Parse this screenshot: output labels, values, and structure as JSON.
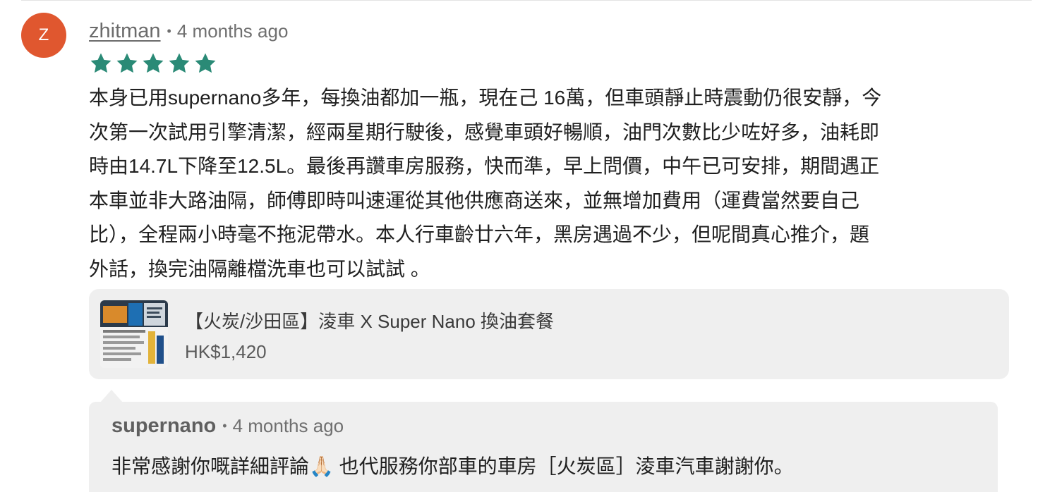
{
  "review": {
    "avatar_initial": "Z",
    "avatar_color": "#e0572f",
    "username": "zhitman",
    "separator": "•",
    "timestamp": "4 months ago",
    "rating": 5,
    "star_color": "#2a8a76",
    "body_lines": [
      "本身已用supernano多年，每換油都加一瓶，現在己 16萬，但車頭靜止時震動仍很安靜，今",
      "次第一次試用引擎清潔，經兩星期行駛後，感覺車頭好暢順，油門次數比少咗好多，油耗即",
      "時由14.7L下降至12.5L。最後再讚車房服務，快而準，早上問價，中午已可安排，期間遇正",
      "本車並非大路油隔，師傅即時叫速運從其他供應商送來，並無增加費用（運費當然要自己",
      "比），全程兩小時毫不拖泥帶水。本人行車齡廿六年，黑房遇過不少，但呢間真心推介，題",
      "外話，換完油隔離檔洗車也可以試試 。"
    ]
  },
  "product": {
    "title": "【火炭/沙田區】淩車 X Super Nano 換油套餐",
    "price": "HK$1,420"
  },
  "reply": {
    "author": "supernano",
    "separator": "•",
    "timestamp": "4 months ago",
    "text": "非常感謝你嘅詳細評論🙏🏻 也代服務你部車的車房［火炭區］淩車汽車謝謝你。"
  }
}
